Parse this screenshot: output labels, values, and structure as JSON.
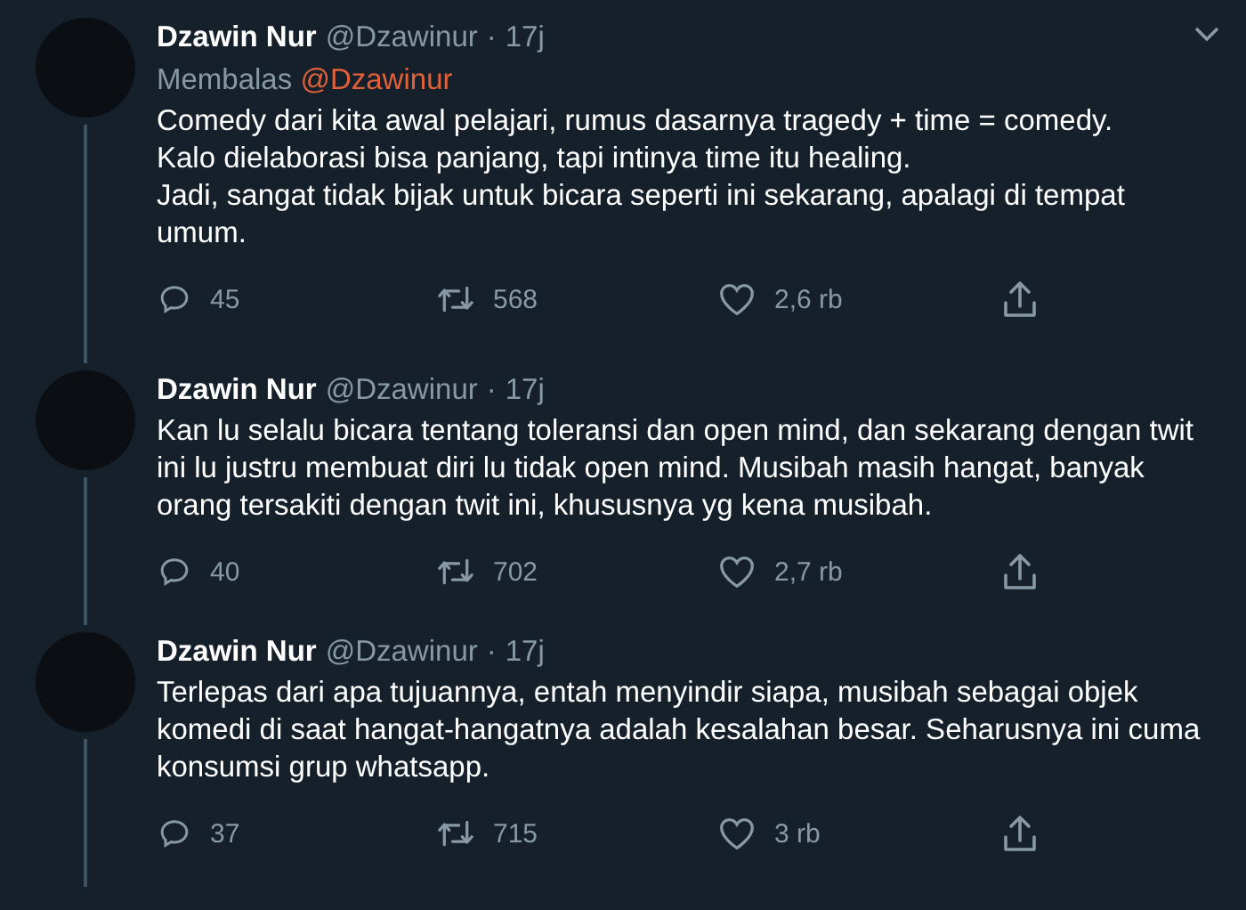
{
  "tweets": [
    {
      "name": "Dzawin Nur",
      "handle": "@Dzawinur",
      "separator": "·",
      "time": "17j",
      "menu": true,
      "reply_prefix": "Membalas",
      "reply_to": "@Dzawinur",
      "text": "Comedy dari kita awal pelajari, rumus dasarnya tragedy + time = comedy.\nKalo dielaborasi bisa panjang, tapi intinya time itu healing.\nJadi, sangat tidak bijak untuk bicara seperti ini sekarang, apalagi di tempat umum.",
      "replies": "45",
      "retweets": "568",
      "likes": "2,6 rb"
    },
    {
      "name": "Dzawin Nur",
      "handle": "@Dzawinur",
      "separator": "·",
      "time": "17j",
      "menu": false,
      "text": "Kan lu selalu bicara tentang toleransi dan open mind, dan sekarang dengan twit ini lu justru membuat diri lu tidak open mind. Musibah masih hangat, banyak orang tersakiti dengan twit ini, khususnya yg kena musibah.",
      "replies": "40",
      "retweets": "702",
      "likes": "2,7 rb"
    },
    {
      "name": "Dzawin Nur",
      "handle": "@Dzawinur",
      "separator": "·",
      "time": "17j",
      "menu": false,
      "text": "Terlepas dari apa tujuannya, entah menyindir siapa, musibah sebagai objek komedi di saat hangat-hangatnya adalah kesalahan besar. Seharusnya ini cuma konsumsi grup whatsapp.",
      "replies": "37",
      "retweets": "715",
      "likes": "3 rb"
    }
  ]
}
